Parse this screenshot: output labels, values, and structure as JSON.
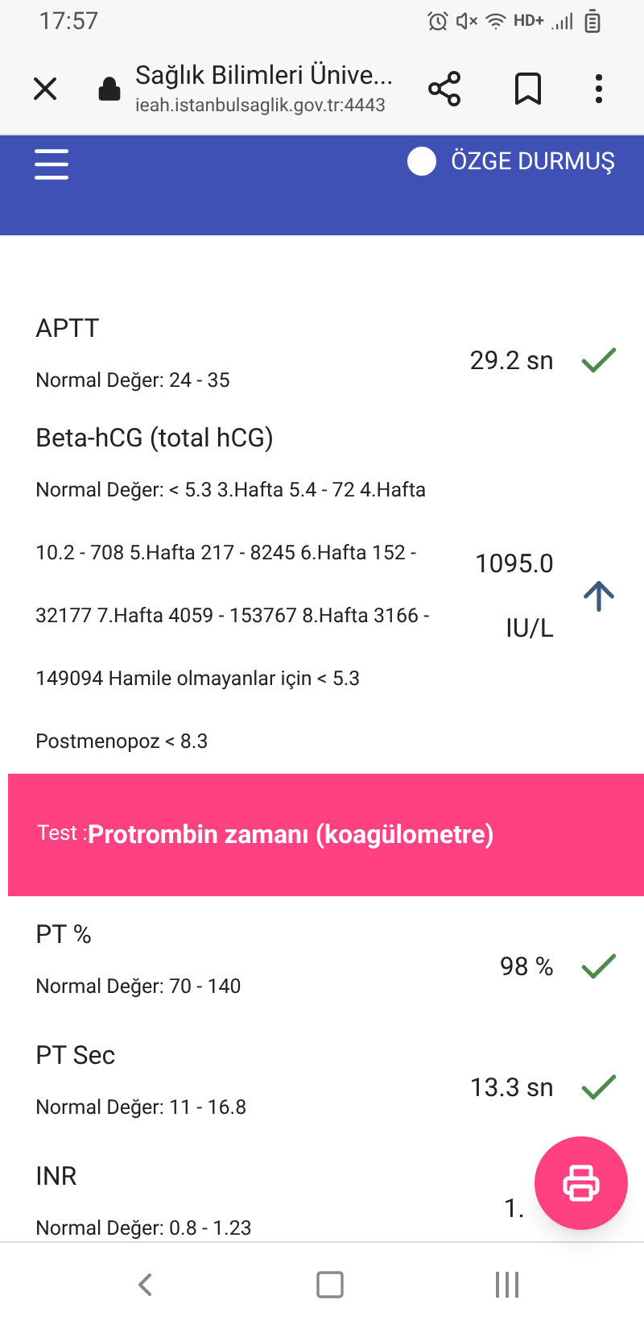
{
  "status_bar": {
    "time": "17:57",
    "network": "HD+"
  },
  "browser": {
    "title": "Sağlık Bilimleri Ünive...",
    "url": "ieah.istanbulsaglik.gov.tr:4443"
  },
  "header": {
    "user": "ÖZGE DURMUŞ"
  },
  "sections": [
    {
      "kind": "results",
      "results": [
        {
          "name": "APTT",
          "normal": "Normal Değer: 24 - 35",
          "value": "29.2 sn",
          "kind": "normal"
        },
        {
          "name": "Beta-hCG (total hCG)",
          "normal": "Normal Değer: < 5.3 3.Hafta 5.4 - 72 4.Hafta 10.2 - 708 5.Hafta 217 - 8245 6.Hafta 152 - 32177 7.Hafta 4059 - 153767 8.Hafta 3166 - 149094 Hamile olmayanlar için < 5.3",
          "normal_extra": "Postmenopoz < 8.3",
          "value": "1095.0 IU/L",
          "kind": "high"
        }
      ]
    },
    {
      "kind": "test",
      "label": "Test :",
      "title": "Protrombin zamanı (koagülometre)"
    },
    {
      "kind": "results",
      "results": [
        {
          "name": "PT %",
          "normal": "Normal Değer: 70 - 140",
          "value": "98 %",
          "kind": "normal"
        },
        {
          "name": "PT Sec",
          "normal": "Normal Değer: 11 - 16.8",
          "value": "13.3 sn",
          "kind": "normal"
        },
        {
          "name": "INR",
          "normal": "Normal Değer: 0.8 - 1.23",
          "value": "1.",
          "kind": "covered"
        }
      ]
    }
  ]
}
